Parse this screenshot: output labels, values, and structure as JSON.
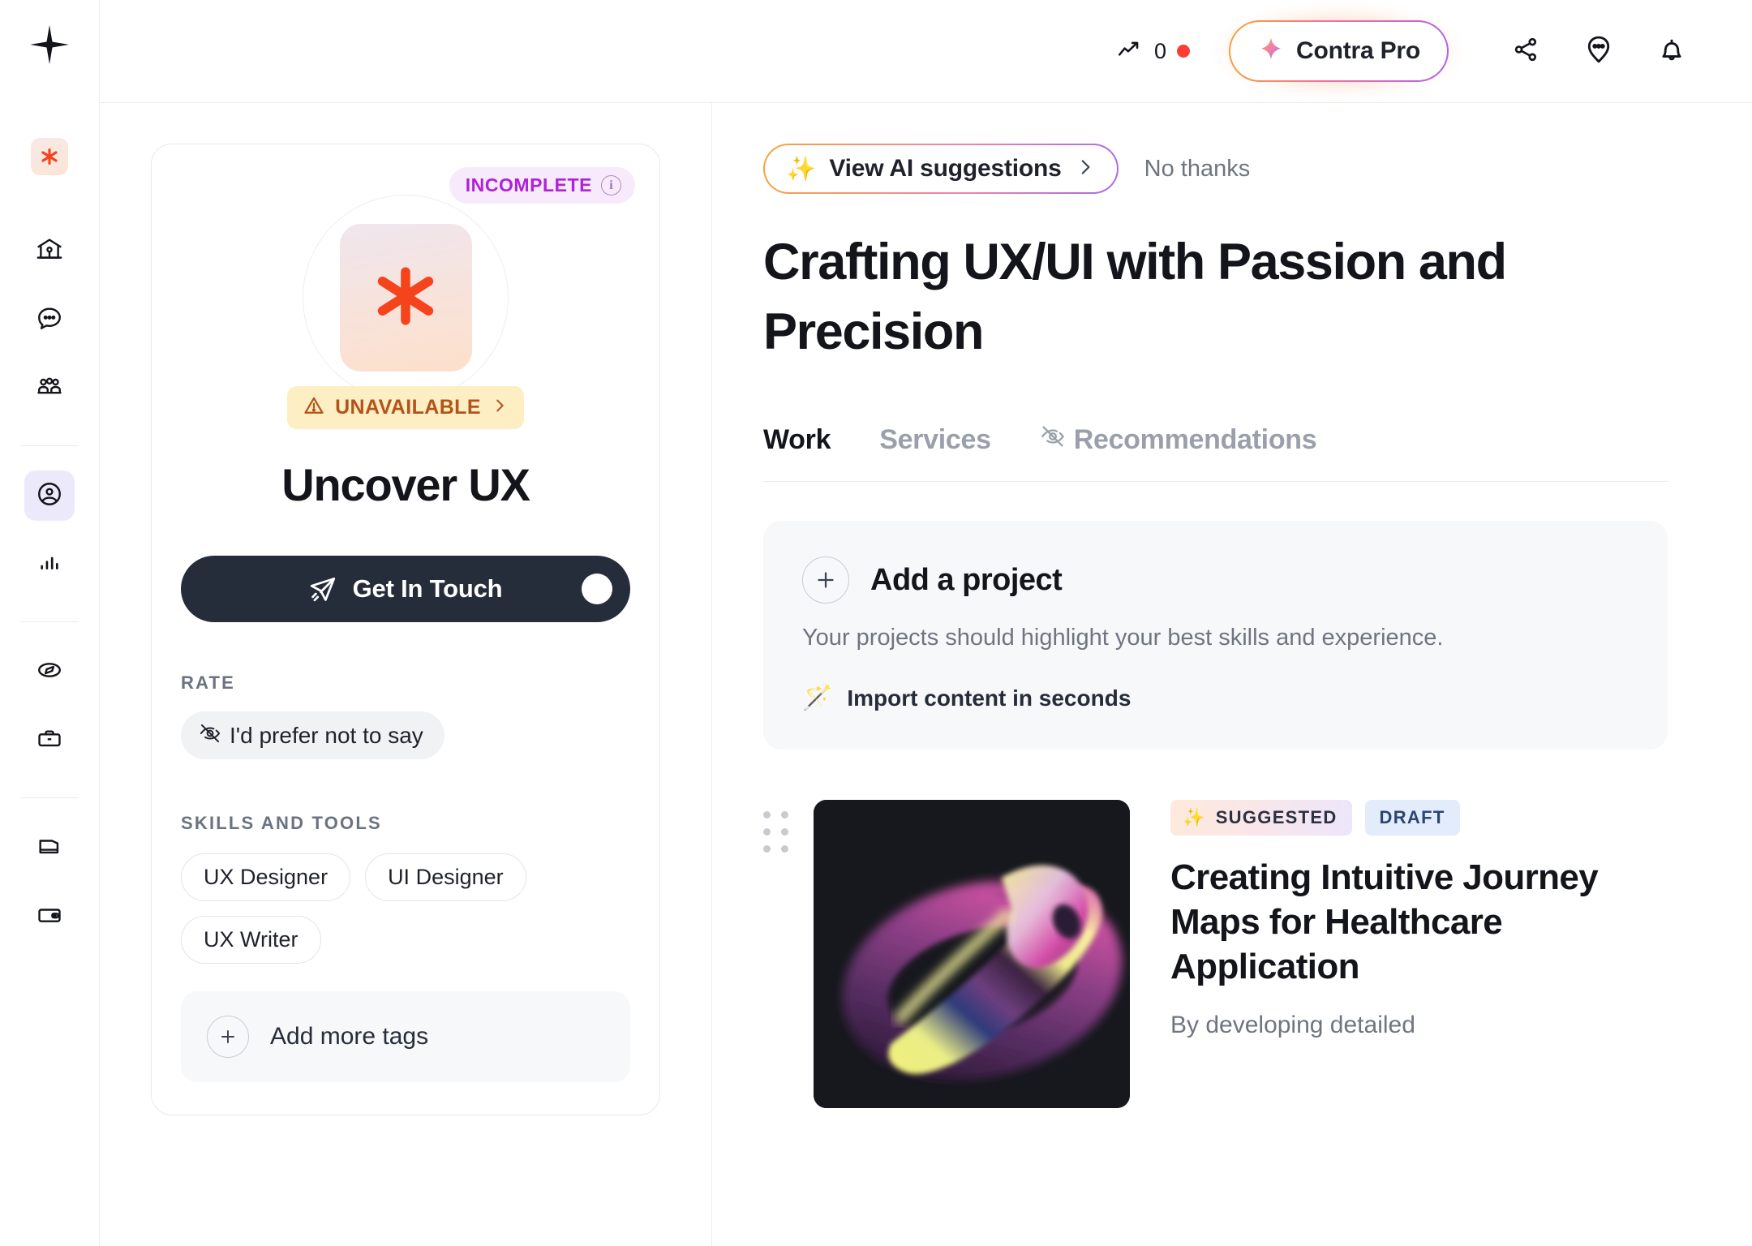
{
  "rail": {
    "logo_icon": "contra-logo-icon",
    "brand_badge_icon": "asterisk-brand-icon",
    "items": [
      {
        "name": "home",
        "icon": "home-icon",
        "active": false
      },
      {
        "name": "messages",
        "icon": "chat-bubble-icon",
        "active": false
      },
      {
        "name": "community",
        "icon": "people-group-icon",
        "active": false
      },
      {
        "name": "profile",
        "icon": "user-circle-icon",
        "active": true
      },
      {
        "name": "analytics",
        "icon": "bar-chart-icon",
        "active": false
      },
      {
        "name": "discover",
        "icon": "compass-icon",
        "active": false
      },
      {
        "name": "jobs",
        "icon": "briefcase-icon",
        "active": false
      },
      {
        "name": "documents",
        "icon": "file-icon",
        "active": false
      },
      {
        "name": "wallet",
        "icon": "wallet-icon",
        "active": false
      }
    ]
  },
  "topbar": {
    "trend_icon": "trending-up-icon",
    "trend_count": "0",
    "status_dot_color": "#fa3e35",
    "pro_label": "Contra Pro",
    "pro_icon": "sparkle-four-point-icon",
    "share_icon": "share-nodes-icon",
    "support_icon": "chat-dots-icon",
    "bell_icon": "bell-icon"
  },
  "profile": {
    "incomplete_badge": "INCOMPLETE",
    "incomplete_info_icon": "info-icon",
    "incomplete_color": "#af22d7",
    "avatar_icon": "asterisk-avatar-icon",
    "availability_badge": "UNAVAILABLE",
    "availability_icon": "warning-triangle-icon",
    "availability_chevron": "chevron-right-icon",
    "availability_color": "#b2541a",
    "name": "Uncover UX",
    "cta_label": "Get In Touch",
    "cta_icon": "paper-plane-icon",
    "rate_section_label": "RATE",
    "rate_value": "I'd prefer not to say",
    "rate_icon": "eye-off-icon",
    "skills_section_label": "SKILLS AND TOOLS",
    "skills": [
      "UX Designer",
      "UI Designer",
      "UX Writer"
    ],
    "add_tags_label": "Add more tags",
    "add_tags_icon": "plus-circle-icon"
  },
  "content": {
    "ai_suggestions_label": "View AI suggestions",
    "ai_suggestions_icon": "sparkles-emoji",
    "ai_suggestions_chevron": "chevron-right-icon",
    "no_thanks_label": "No thanks",
    "headline": "Crafting UX/UI with Passion and Precision",
    "tabs": [
      {
        "label": "Work",
        "active": true,
        "icon": null
      },
      {
        "label": "Services",
        "active": false,
        "icon": null
      },
      {
        "label": "Recommendations",
        "active": false,
        "icon": "eye-off-icon"
      }
    ],
    "add_project": {
      "title": "Add a project",
      "plus_icon": "plus-circle-icon",
      "subtitle": "Your projects should highlight your best skills and experience.",
      "import_label": "Import content in seconds",
      "import_icon": "magic-wand-emoji"
    },
    "projects": [
      {
        "drag_icon": "drag-handle-icon",
        "thumbnail_icon": "abstract-3d-iridescent-torus-image",
        "badges": [
          {
            "label": "SUGGESTED",
            "icon": "sparkles-emoji",
            "style": "suggested"
          },
          {
            "label": "DRAFT",
            "icon": null,
            "style": "draft"
          }
        ],
        "title": "Creating Intuitive Journey Maps for Healthcare Application",
        "description": "By developing detailed"
      }
    ]
  }
}
